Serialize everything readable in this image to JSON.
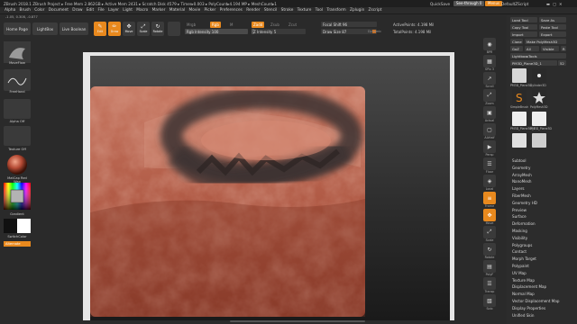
{
  "titlebar": {
    "title": "ZBrush 2018.1    ZBrush Project   ▸ Free Mem 2.862GB ▸ Active Mem 2431 ▸ Scratch Disk 4579 ▸ Timer▸0.003 ▸ PolyCount▸4.194 MP ▸ MeshCount▸1",
    "quicksave": "QuickSave",
    "see_through": "See-through  0",
    "menus": "Menus",
    "script": "DefaultZScript"
  },
  "menubar": [
    "Alpha",
    "Brush",
    "Color",
    "Document",
    "Draw",
    "Edit",
    "File",
    "Layer",
    "Light",
    "Macro",
    "Marker",
    "Material",
    "Movie",
    "Picker",
    "Preferences",
    "Render",
    "Stencil",
    "Stroke",
    "Texture",
    "Tool",
    "Transform",
    "Zplugin",
    "Zscript"
  ],
  "infobar": "-1.05, 0.308, -0.877",
  "shelf": {
    "home": "Home Page",
    "lightbox": "LightBox",
    "live_boolean": "Live Boolean"
  },
  "tools": [
    {
      "name": "Edit",
      "icon": "✎",
      "on": true
    },
    {
      "name": "Draw",
      "icon": "✏",
      "on": true
    },
    {
      "name": "Move",
      "icon": "✥",
      "on": false
    },
    {
      "name": "Scale",
      "icon": "⤢",
      "on": false
    },
    {
      "name": "Rotate",
      "icon": "↻",
      "on": false
    }
  ],
  "brush_settings": {
    "mrgb": "Mrgb",
    "rgb": "Rgb",
    "m": "M",
    "rgb_intensity": "Rgb Intensity 100",
    "rgb_intensity_value": 100,
    "zadd": "Zadd",
    "zsub": "Zsub",
    "zcut": "Zcut",
    "z_intensity": "Z Intensity 5",
    "z_intensity_value": 5,
    "focal_shift": "Focal Shift 96",
    "focal_shift_value": 96,
    "draw_size": "Draw Size 87",
    "draw_size_value": 87,
    "dynamic": "Dynamic",
    "active_points": "ActivePoints: 4.198 Mil",
    "total_points": "TotalPoints: 4.198 Mil"
  },
  "left_shelf": {
    "brush": "MoveFlow",
    "stroke": "FreeHand",
    "alpha": "Alpha Off",
    "texture": "Texture Off",
    "material": "MatCap Red Wax",
    "gradient": "Gradient",
    "switch_color": "SwitchColor",
    "alternate": "Alternate"
  },
  "right_strip": [
    {
      "icon": "◉",
      "label": "BPR"
    },
    {
      "icon": "▦",
      "label": "SPix 3"
    },
    {
      "icon": "↗",
      "label": "Scroll"
    },
    {
      "icon": "⤢",
      "label": "Zoom"
    },
    {
      "icon": "▣",
      "label": "Actual"
    },
    {
      "icon": "▢",
      "label": "AAHalf"
    },
    {
      "icon": "▶",
      "label": "Persp"
    },
    {
      "icon": "☰",
      "label": "Floor"
    },
    {
      "icon": "◈",
      "label": "Local"
    },
    {
      "icon": "≡",
      "label": "Frame"
    },
    {
      "icon": "✥",
      "label": "Move"
    },
    {
      "icon": "⤢",
      "label": "Scale"
    },
    {
      "icon": "↻",
      "label": "Rotate"
    },
    {
      "icon": "▤",
      "label": "PolyF"
    },
    {
      "icon": "☰",
      "label": "Transp"
    },
    {
      "icon": "▧",
      "label": "Solo"
    }
  ],
  "tool_panel": {
    "load_tool": "Load Tool",
    "save_as": "Save As",
    "copy_tool": "Copy Tool",
    "paste_tool": "Paste Tool",
    "import": "Import",
    "export": "Export",
    "clone": "Clone",
    "make_polymesh": "Make PolyMesh3D",
    "goz": "GoZ",
    "all": "All",
    "visible": "Visible",
    "r": "R",
    "lightbox_tools": "Lightbox▸Tools",
    "current_tool": "PM3D_Plane3D_1",
    "current_tool_count": "52",
    "thumbs": [
      "PM3D_Plane3D",
      "Cylinder3D",
      "SimpleBrush",
      "PolyMesh3D",
      "PM3D_Plane3D_1",
      "PM3D_Plane3D"
    ],
    "subpalettes": [
      "Subtool",
      "Geometry",
      "ArrayMesh",
      "NanoMesh",
      "Layers",
      "FiberMesh",
      "Geometry HD",
      "Preview",
      "Surface",
      "Deformation",
      "Masking",
      "Visibility",
      "Polygroups",
      "Contact",
      "Morph Target",
      "Polypaint",
      "UV Map",
      "Texture Map",
      "Displacement Map",
      "Normal Map",
      "Vector Displacement Map",
      "Display Properties",
      "Unified Skin"
    ]
  },
  "colors": {
    "accent": "#e8891e",
    "terrain": "#b5604c",
    "background": "#2a2a2a"
  }
}
